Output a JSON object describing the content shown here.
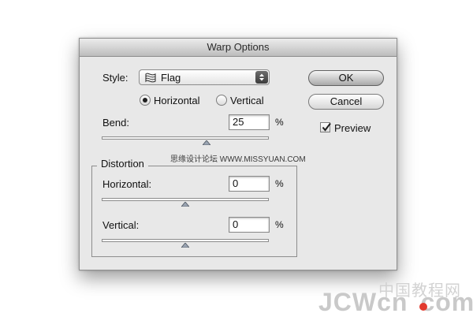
{
  "dialog": {
    "title": "Warp Options",
    "style_label": "Style:",
    "style_value": "Flag",
    "orientation": {
      "horizontal_label": "Horizontal",
      "vertical_label": "Vertical",
      "selected": "horizontal"
    },
    "bend": {
      "label": "Bend:",
      "value": "25",
      "unit": "%",
      "slider_percent": 25
    },
    "distortion": {
      "group_label": "Distortion",
      "horizontal": {
        "label": "Horizontal:",
        "value": "0",
        "unit": "%",
        "slider_percent": 0
      },
      "vertical": {
        "label": "Vertical:",
        "value": "0",
        "unit": "%",
        "slider_percent": 0
      }
    },
    "buttons": {
      "ok": "OK",
      "cancel": "Cancel"
    },
    "preview": {
      "label": "Preview",
      "checked": true
    }
  },
  "watermarks": {
    "small": "思缘设计论坛 WWW.MISSYUAN.COM",
    "cn": "中国教程网",
    "jc": "JCWcn",
    "com": "com"
  },
  "icons": {
    "style_icon": "flag-warp-icon",
    "dropdown_icon": "up-down-arrows-icon",
    "check_icon": "checkmark-icon",
    "slider_icon": "triangle-thumb-icon"
  },
  "colors": {
    "dialog_bg": "#e8e8e8",
    "accent_dot": "#e23a2e"
  }
}
